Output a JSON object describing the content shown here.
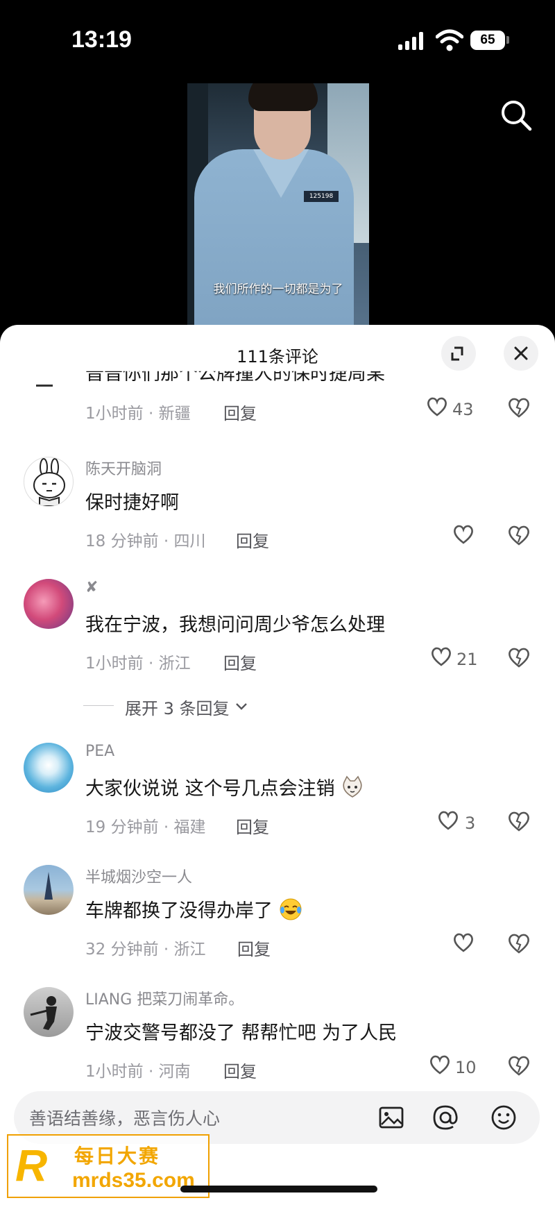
{
  "status": {
    "time": "13:19",
    "battery": "65"
  },
  "video": {
    "subtitle": "我们所作的一切都是为了",
    "badge_number": "125198"
  },
  "sheet": {
    "title": "111条评论"
  },
  "partial_comment": {
    "text_fragment": "普普你们那个公牌撞人的保时捷周某",
    "meta": "1小时前 · 新疆",
    "reply": "回复",
    "likes": "43"
  },
  "comments": [
    {
      "username": "陈天开脑洞",
      "text": "保时捷好啊",
      "meta": "18 分钟前 · 四川",
      "reply": "回复",
      "likes": ""
    },
    {
      "username": "✘",
      "text": "我在宁波，我想问问周少爷怎么处理",
      "meta": "1小时前 · 浙江",
      "reply": "回复",
      "likes": "21"
    },
    {
      "username": "PEA",
      "text": "大家伙说说 这个号几点会注销",
      "meta": "19 分钟前 · 福建",
      "reply": "回复",
      "likes": "3"
    },
    {
      "username": "半城烟沙空一人",
      "text": "车牌都换了没得办岸了",
      "meta": "32 分钟前 · 浙江",
      "reply": "回复",
      "likes": ""
    },
    {
      "username": "LIANG 把菜刀闹革命。",
      "text": "宁波交警号都没了  帮帮忙吧  为了人民",
      "meta": "1小时前 · 河南",
      "reply": "回复",
      "likes": "10"
    }
  ],
  "expand_replies": "展开 3 条回复",
  "input": {
    "placeholder": "善语结善缘，恶言伤人心"
  },
  "watermark": {
    "logo": "R",
    "name": "每日大赛",
    "site": "mrds35.com"
  },
  "icons": [
    "search-icon",
    "expand-icon",
    "close-icon",
    "heart-icon",
    "dislike-icon",
    "image-icon",
    "at-icon",
    "emoji-icon",
    "chevron-down-icon"
  ]
}
